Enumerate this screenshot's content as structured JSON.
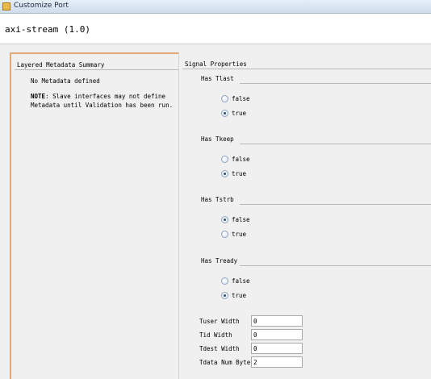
{
  "window": {
    "title": "Customize Port"
  },
  "header": {
    "title": "axi-stream (1.0)"
  },
  "left_panel": {
    "title": "Layered Metadata Summary",
    "no_metadata": "No Metadata defined",
    "note_bold": "NOTE",
    "note_line1_rest": ": Slave interfaces may not define",
    "note_line2": "Metadata until Validation has been run."
  },
  "signal_properties": {
    "title": "Signal Properties",
    "groups": [
      {
        "label": "Has Tlast",
        "options": [
          {
            "label": "false",
            "checked": false
          },
          {
            "label": "true",
            "checked": true
          }
        ]
      },
      {
        "label": "Has Tkeep",
        "options": [
          {
            "label": "false",
            "checked": false
          },
          {
            "label": "true",
            "checked": true
          }
        ]
      },
      {
        "label": "Has Tstrb",
        "options": [
          {
            "label": "false",
            "checked": true
          },
          {
            "label": "true",
            "checked": false
          }
        ]
      },
      {
        "label": "Has Tready",
        "options": [
          {
            "label": "false",
            "checked": false
          },
          {
            "label": "true",
            "checked": true
          }
        ]
      }
    ],
    "fields": [
      {
        "label": "Tuser Width",
        "value": "0"
      },
      {
        "label": "Tid Width",
        "value": "0"
      },
      {
        "label": "Tdest Width",
        "value": "0"
      },
      {
        "label": "Tdata Num Bytes",
        "value": "2"
      }
    ]
  }
}
